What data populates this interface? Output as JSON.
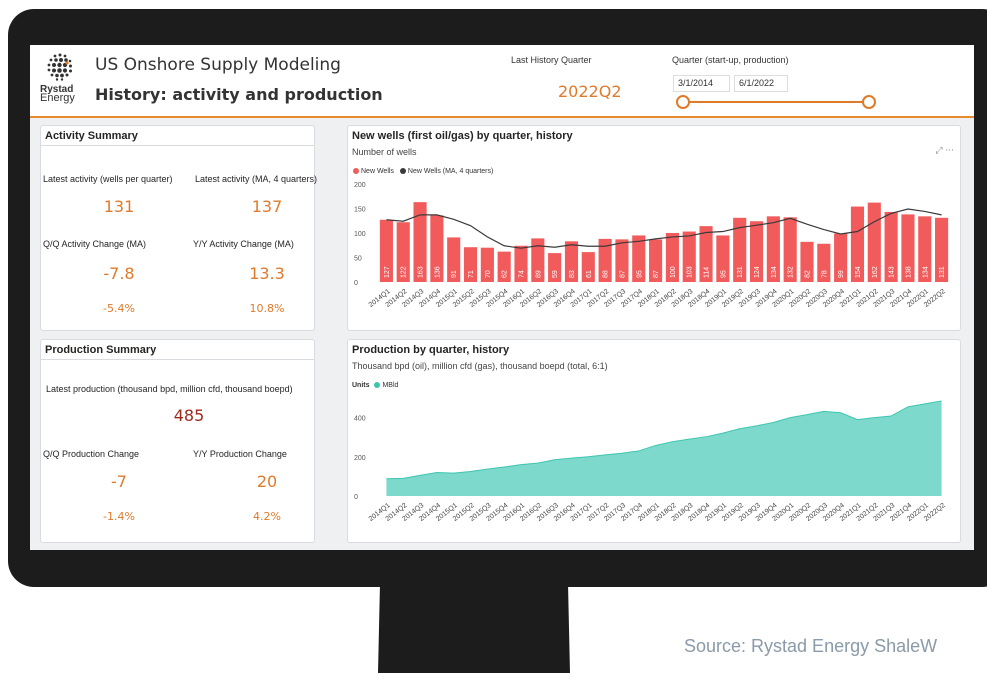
{
  "header": {
    "logo_line1": "Rystad",
    "logo_line2": "Energy",
    "title": "US Onshore Supply Modeling",
    "subtitle": "History: activity and production",
    "last_history_label": "Last History Quarter",
    "last_history_value": "2022Q2",
    "quarter_label": "Quarter (start-up, production)",
    "date_start": "3/1/2014",
    "date_end": "6/1/2022"
  },
  "activity": {
    "title": "Activity Summary",
    "latest_label": "Latest activity (wells per quarter)",
    "latest_value": "131",
    "latest_ma_label": "Latest activity (MA, 4 quarters)",
    "latest_ma_value": "137",
    "qq_label": "Q/Q Activity Change (MA)",
    "qq_value": "-7.8",
    "qq_pct": "-5.4%",
    "yy_label": "Y/Y Activity Change (MA)",
    "yy_value": "13.3",
    "yy_pct": "10.8%"
  },
  "production": {
    "title": "Production Summary",
    "latest_label": "Latest production (thousand bpd, million cfd, thousand boepd)",
    "latest_value": "485",
    "qq_label": "Q/Q Production Change",
    "qq_value": "-7",
    "qq_pct": "-1.4%",
    "yy_label": "Y/Y Production Change",
    "yy_value": "20",
    "yy_pct": "4.2%"
  },
  "wells_panel": {
    "title": "New wells (first oil/gas) by quarter, history",
    "subtitle": "Number of wells",
    "tools": "⤢ ···"
  },
  "prod_panel": {
    "title": "Production by quarter, history",
    "subtitle": "Thousand bpd (oil), million cfd (gas), thousand boepd (total, 6:1)"
  },
  "source": "Source: Rystad Energy ShaleW",
  "colors": {
    "accent": "#e07a2b",
    "bar": "#f15b5b",
    "area": "#7dd9cc",
    "line": "#3a3a3a"
  },
  "chart_data": [
    {
      "type": "bar",
      "categories": [
        "2014Q1",
        "2014Q2",
        "2014Q3",
        "2014Q4",
        "2015Q1",
        "2015Q2",
        "2015Q3",
        "2015Q4",
        "2016Q1",
        "2016Q2",
        "2016Q3",
        "2016Q4",
        "2017Q1",
        "2017Q2",
        "2017Q3",
        "2017Q4",
        "2018Q1",
        "2018Q2",
        "2018Q3",
        "2018Q4",
        "2019Q1",
        "2019Q2",
        "2019Q3",
        "2019Q4",
        "2020Q1",
        "2020Q2",
        "2020Q3",
        "2020Q4",
        "2021Q1",
        "2021Q2",
        "2021Q3",
        "2021Q4",
        "2022Q1",
        "2022Q2"
      ],
      "series": [
        {
          "name": "New Wells",
          "values": [
            127,
            122,
            163,
            136,
            91,
            71,
            70,
            62,
            74,
            89,
            59,
            83,
            61,
            88,
            87,
            95,
            87,
            100,
            103,
            114,
            95,
            131,
            124,
            134,
            132,
            82,
            78,
            99,
            154,
            162,
            143,
            138,
            134,
            131
          ]
        },
        {
          "name": "New Wells (MA, 4 quarters)",
          "values": [
            127,
            124,
            137,
            137,
            128,
            115,
            92,
            74,
            69,
            74,
            71,
            76,
            73,
            73,
            80,
            83,
            88,
            92,
            94,
            101,
            103,
            111,
            116,
            121,
            130,
            118,
            107,
            98,
            103,
            123,
            140,
            149,
            144,
            137
          ]
        }
      ],
      "ylim": [
        0,
        200
      ],
      "yticks": [
        0,
        50,
        100,
        150,
        200
      ],
      "legend": "top-left"
    },
    {
      "type": "area",
      "categories": [
        "2014Q1",
        "2014Q2",
        "2014Q3",
        "2014Q4",
        "2015Q1",
        "2015Q2",
        "2015Q3",
        "2015Q4",
        "2016Q1",
        "2016Q2",
        "2016Q3",
        "2016Q4",
        "2017Q1",
        "2017Q2",
        "2017Q3",
        "2017Q4",
        "2018Q1",
        "2018Q2",
        "2018Q3",
        "2018Q4",
        "2019Q1",
        "2019Q2",
        "2019Q3",
        "2019Q4",
        "2020Q1",
        "2020Q2",
        "2020Q3",
        "2020Q4",
        "2021Q1",
        "2021Q2",
        "2021Q3",
        "2021Q4",
        "2022Q1",
        "2022Q2"
      ],
      "series": [
        {
          "name": "MBld",
          "values": [
            88,
            90,
            105,
            120,
            117,
            125,
            137,
            148,
            160,
            168,
            185,
            193,
            200,
            210,
            218,
            230,
            258,
            277,
            290,
            302,
            321,
            343,
            358,
            375,
            400,
            415,
            432,
            425,
            390,
            400,
            408,
            455,
            470,
            485
          ]
        }
      ],
      "legend_title": "Units",
      "ylim": [
        0,
        500
      ],
      "yticks": [
        0,
        200,
        400
      ],
      "legend": "top-left"
    }
  ]
}
